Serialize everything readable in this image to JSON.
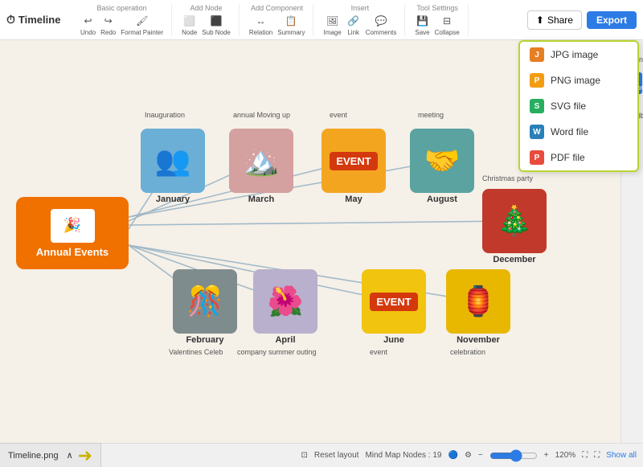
{
  "app": {
    "title": "Timeline"
  },
  "toolbar": {
    "sections": [
      {
        "label": "Basic operation",
        "icons": [
          "Undo",
          "Redo",
          "Format Painter"
        ]
      },
      {
        "label": "Add Node",
        "icons": [
          "Node",
          "Sub Node"
        ]
      },
      {
        "label": "Add Component",
        "icons": [
          "Relation",
          "Summary"
        ]
      },
      {
        "label": "Insert",
        "icons": [
          "Image",
          "Link",
          "Comments"
        ]
      },
      {
        "label": "Tool Settings",
        "icons": [
          "Save",
          "Collapse"
        ]
      }
    ],
    "share_label": "Share",
    "export_label": "Export"
  },
  "export_menu": {
    "items": [
      {
        "label": "JPG image",
        "type": "jpg"
      },
      {
        "label": "PNG image",
        "type": "png"
      },
      {
        "label": "SVG file",
        "type": "svg"
      },
      {
        "label": "Word file",
        "type": "word"
      },
      {
        "label": "PDF file",
        "type": "pdf"
      }
    ]
  },
  "right_sidebar": {
    "items": [
      {
        "label": "Outline",
        "active": false
      },
      {
        "label": "History",
        "active": true
      },
      {
        "label": "Feedback",
        "active": false
      }
    ]
  },
  "mindmap": {
    "central_node": {
      "emoji": "🎉",
      "title": "Annual Events"
    },
    "nodes": [
      {
        "id": "january",
        "label": "January",
        "annotation_top": "Inauguration",
        "emoji": "👥",
        "color": "blue"
      },
      {
        "id": "march",
        "label": "March",
        "annotation_top": "annual Moving up",
        "emoji": "🏔️",
        "color": "pink"
      },
      {
        "id": "may",
        "label": "May",
        "annotation_top": "event",
        "text": "EVENT",
        "color": "orange"
      },
      {
        "id": "august",
        "label": "August",
        "annotation_top": "meeting",
        "emoji": "🤝",
        "color": "teal"
      },
      {
        "id": "december",
        "label": "December",
        "annotation_top": "Christmas party",
        "emoji": "🎄",
        "color": "red"
      },
      {
        "id": "february",
        "label": "February",
        "annotation_bottom": "Valentines Celeb",
        "emoji": "🎊",
        "color": "gray"
      },
      {
        "id": "april",
        "label": "April",
        "annotation_bottom": "company summer outing",
        "emoji": "🌺",
        "color": "lavender"
      },
      {
        "id": "june",
        "label": "June",
        "annotation_bottom": "event",
        "text": "EVENT",
        "color": "yellow"
      },
      {
        "id": "november",
        "label": "November",
        "annotation_bottom": "celebration",
        "emoji": "🏮",
        "color": "yellow2"
      }
    ]
  },
  "statusbar": {
    "reset_label": "Reset layout",
    "nodes_label": "Mind Map Nodes : 19",
    "zoom_level": "120%",
    "show_all_label": "Show all"
  },
  "file_tab": {
    "name": "Timeline.png"
  }
}
